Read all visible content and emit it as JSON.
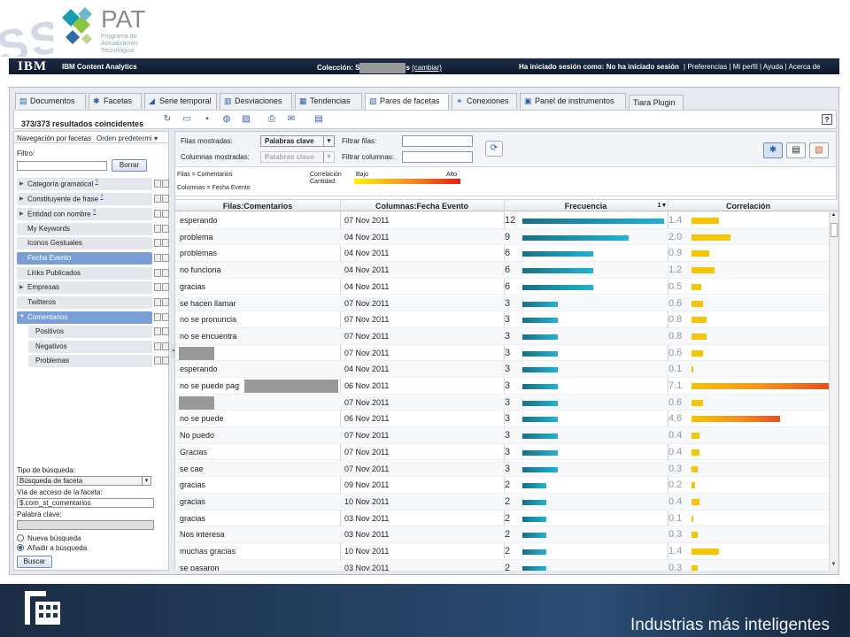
{
  "banner": {
    "watermark": "SS P",
    "logo": "PAT",
    "logo_sub_1": "Programa de",
    "logo_sub_2": "Actualización Tecnológica"
  },
  "ibm_bar": {
    "brand": "IBM",
    "product": "IBM Content Analytics",
    "collection_label": "Colección: S",
    "collection_suffix": "s",
    "change_link": "(cambiar)",
    "session": "Ha iniciado sesión como: No ha iniciado sesión",
    "links": [
      "Preferencias",
      "Mi perfil",
      "Ayuda",
      "Acerca de"
    ]
  },
  "tabs": [
    {
      "label": "Documentos",
      "icon": "doc-icon"
    },
    {
      "label": "Facetas",
      "icon": "facets-icon"
    },
    {
      "label": "Serie temporal",
      "icon": "timeseries-icon"
    },
    {
      "label": "Desviaciones",
      "icon": "deviation-icon"
    },
    {
      "label": "Tendencias",
      "icon": "trend-icon"
    },
    {
      "label": "Pares de facetas",
      "icon": "pairs-icon",
      "active": true
    },
    {
      "label": "Conexiones",
      "icon": "connections-icon"
    },
    {
      "label": "Panel de instrumentos",
      "icon": "dashboard-icon"
    },
    {
      "label": "Tiara Plugin",
      "icon": ""
    }
  ],
  "results_count": "373/373 resultados coincidentes",
  "help_label": "?",
  "sidebar": {
    "nav_label": "Navegación por facetas",
    "sort_label": "Orden predetermi",
    "filter_label": "Filtro:",
    "filter_value": "",
    "clear_button": "Borrar",
    "facets": [
      {
        "label": "Categoría gramatical",
        "sup": "?",
        "expandable": true
      },
      {
        "label": "Constituyente de frase",
        "sup": "?",
        "expandable": true
      },
      {
        "label": "Entidad con nombre",
        "sup": "?",
        "expandable": true
      },
      {
        "label": "My Keywords"
      },
      {
        "label": "Iconos Gestuales"
      },
      {
        "label": "Fecha Evento",
        "selected": true
      },
      {
        "label": "Links Publicados"
      },
      {
        "label": "Empresas",
        "expandable": true
      },
      {
        "label": "Twitteros"
      },
      {
        "label": "Comentarios",
        "selected": true,
        "expanded": true
      },
      {
        "label": "Positivos",
        "child": true
      },
      {
        "label": "Negativos",
        "child": true
      },
      {
        "label": "Problemas",
        "child": true
      }
    ],
    "search_type_label": "Tipo de búsqueda:",
    "search_type_value": "Búsqueda de faceta",
    "facet_path_label": "Vía de acceso de la faceta:",
    "facet_path_value": "$.com_st_comentarios",
    "keyword_label": "Palabra clave:",
    "keyword_value": "",
    "radio_new": "Nueva búsqueda",
    "radio_add": "Añadir a búsqueda",
    "search_button": "Buscar"
  },
  "controls": {
    "rows_shown_label": "Filas mostradas:",
    "rows_shown_value": "Palabras clave",
    "cols_shown_label": "Columnas mostradas:",
    "cols_shown_value": "Palabras clave",
    "filter_rows_label": "Filtrar filas:",
    "filter_cols_label": "Filtrar columnas:"
  },
  "legend": {
    "rows_def": "Filas = Comentarios",
    "cols_def": "Columnas = Fecha Evento",
    "correlation": "Correlación",
    "quantity": "Cantidad:",
    "low": "Bajo",
    "high": "Alto"
  },
  "table": {
    "headers": [
      "Filas:Comentarios",
      "Columnas:Fecha Evento",
      "Frecuencia",
      "Correlación"
    ],
    "sort_indicator": "1▼",
    "rows": [
      {
        "row": "esperando",
        "col": "07 Nov 2011",
        "freq": 12,
        "corr": 1.4
      },
      {
        "row": "problema",
        "col": "04 Nov 2011",
        "freq": 9,
        "corr": 2.0
      },
      {
        "row": "problemas",
        "col": "04 Nov 2011",
        "freq": 6,
        "corr": 0.9
      },
      {
        "row": "no funciona",
        "col": "04 Nov 2011",
        "freq": 6,
        "corr": 1.2
      },
      {
        "row": "gracias",
        "col": "04 Nov 2011",
        "freq": 6,
        "corr": 0.5
      },
      {
        "row": "se hacen llamar",
        "col": "07 Nov 2011",
        "freq": 3,
        "corr": 0.6
      },
      {
        "row": "no se pronuncia",
        "col": "07 Nov 2011",
        "freq": 3,
        "corr": 0.8
      },
      {
        "row": "no se encuentra",
        "col": "07 Nov 2011",
        "freq": 3,
        "corr": 0.8
      },
      {
        "row": "",
        "col": "07 Nov 2011",
        "freq": 3,
        "corr": 0.6,
        "redacted": true
      },
      {
        "row": "esperando",
        "col": "04 Nov 2011",
        "freq": 3,
        "corr": 0.1
      },
      {
        "row": "no se puede pag",
        "col": "06 Nov 2011",
        "freq": 3,
        "corr": 7.1,
        "redacted_tail": true
      },
      {
        "row": "",
        "col": "07 Nov 2011",
        "freq": 3,
        "corr": 0.6,
        "redacted": true
      },
      {
        "row": "no se puede",
        "col": "06 Nov 2011",
        "freq": 3,
        "corr": 4.6
      },
      {
        "row": "No puedo",
        "col": "07 Nov 2011",
        "freq": 3,
        "corr": 0.4
      },
      {
        "row": "Gracias",
        "col": "07 Nov 2011",
        "freq": 3,
        "corr": 0.4
      },
      {
        "row": "se cae",
        "col": "07 Nov 2011",
        "freq": 3,
        "corr": 0.3
      },
      {
        "row": "gracias",
        "col": "09 Nov 2011",
        "freq": 2,
        "corr": 0.2
      },
      {
        "row": "gracias",
        "col": "10 Nov 2011",
        "freq": 2,
        "corr": 0.4
      },
      {
        "row": "gracias",
        "col": "03 Nov 2011",
        "freq": 2,
        "corr": 0.1
      },
      {
        "row": "Nos interesa",
        "col": "03 Nov 2011",
        "freq": 2,
        "corr": 0.3
      },
      {
        "row": "muchas gracias",
        "col": "10 Nov 2011",
        "freq": 2,
        "corr": 1.4
      },
      {
        "row": "se pasaron",
        "col": "03 Nov 2011",
        "freq": 2,
        "corr": 0.3
      }
    ]
  },
  "footer": {
    "tagline": "Industrias más inteligentes"
  },
  "colors": {
    "freq_bar": "#1a93b3",
    "corr_low": "#f6c400",
    "corr_mid": "#f7941d",
    "corr_high": "#e8501a",
    "selected_facet": "#7a9fd6"
  }
}
